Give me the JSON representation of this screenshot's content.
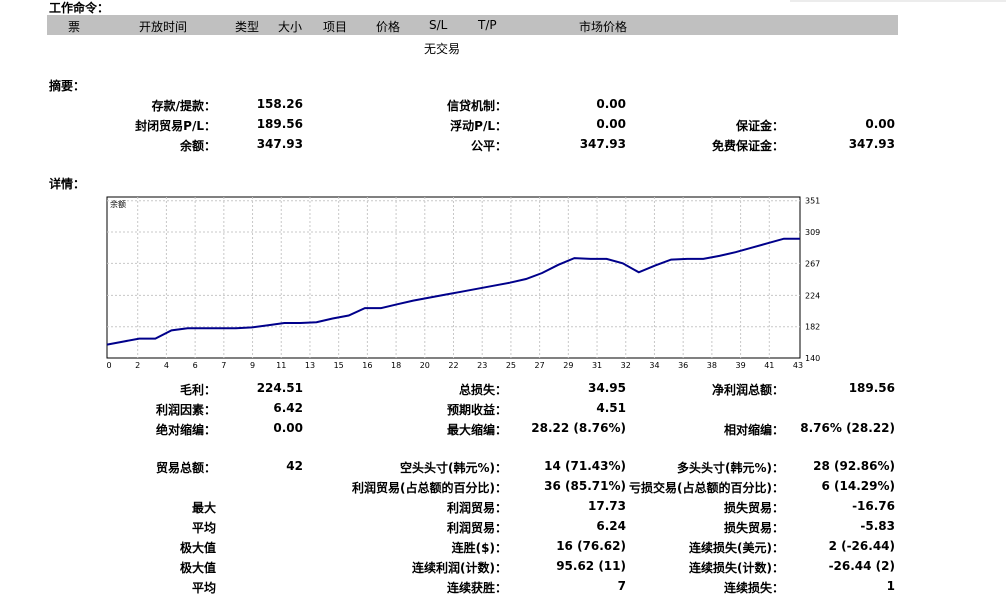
{
  "orders": {
    "title": "工作命令：",
    "columns": [
      "票",
      "开放时间",
      "类型",
      "大小",
      "项目",
      "价格",
      "S/L",
      "T/P",
      "市场价格"
    ],
    "empty_text": "无交易"
  },
  "summary": {
    "title": "摘要：",
    "deposit_label": "存款/提款：",
    "deposit": "158.26",
    "credit_label": "信贷机制：",
    "credit": "0.00",
    "closed_pl_label": "封闭贸易P/L：",
    "closed_pl": "189.56",
    "floating_pl_label": "浮动P/L：",
    "floating_pl": "0.00",
    "margin_label": "保证金：",
    "margin": "0.00",
    "balance_label": "余额：",
    "balance": "347.93",
    "equity_label": "公平：",
    "equity": "347.93",
    "free_margin_label": "免费保证金：",
    "free_margin": "347.93"
  },
  "details": {
    "title": "详情：",
    "gross_profit_label": "毛利：",
    "gross_profit": "224.51",
    "gross_loss_label": "总损失：",
    "gross_loss": "34.95",
    "net_profit_label": "净利润总额：",
    "net_profit": "189.56",
    "profit_factor_label": "利润因素：",
    "profit_factor": "6.42",
    "expected_payoff_label": "预期收益：",
    "expected_payoff": "4.51",
    "abs_dd_label": "绝对缩编：",
    "abs_dd": "0.00",
    "max_dd_label": "最大缩编：",
    "max_dd": "28.22 (8.76%)",
    "rel_dd_label": "相对缩编：",
    "rel_dd": "8.76% (28.22)",
    "total_trades_label": "贸易总额：",
    "total_trades": "42",
    "short_label": "空头头寸(韩元%)：",
    "short": "14 (71.43%)",
    "long_label": "多头头寸(韩元%)：",
    "long": "28 (92.86%)",
    "profit_trades_label": "利润贸易(占总额的百分比)：",
    "profit_trades": "36 (85.71%)",
    "loss_trades_label": "亏损交易(占总额的百分比)：",
    "loss_trades": "6 (14.29%)",
    "largest_label": "最大",
    "largest_profit_label": "利润贸易：",
    "largest_profit": "17.73",
    "largest_loss_label": "损失贸易：",
    "largest_loss": "-16.76",
    "average_label": "平均",
    "avg_profit_label": "利润贸易：",
    "avg_profit": "6.24",
    "avg_loss_label": "损失贸易：",
    "avg_loss": "-5.83",
    "max_label": "极大值",
    "cons_wins_label": "连胜($)：",
    "cons_wins": "16 (76.62)",
    "cons_losses_label": "连续损失(美元)：",
    "cons_losses": "2 (-26.44)",
    "maximal_label": "极大值",
    "cons_profit_label": "连续利润(计数)：",
    "cons_profit": "95.62 (11)",
    "cons_loss_label": "连续损失(计数)：",
    "cons_loss": "-26.44 (2)",
    "avg2_label": "平均",
    "avg_cons_wins_label": "连续获胜：",
    "avg_cons_wins": "7",
    "avg_cons_losses_label": "连续损失：",
    "avg_cons_losses": "1"
  },
  "chart_data": {
    "type": "line",
    "title": "余额",
    "line_color": "#00008b",
    "grid": true,
    "ylim": [
      140,
      356
    ],
    "xlim": [
      0,
      43
    ],
    "y_ticks": [
      "140",
      "182",
      "224",
      "267",
      "309",
      "351"
    ],
    "x_ticks": [
      "0",
      "2",
      "4",
      "6",
      "7",
      "9",
      "11",
      "13",
      "15",
      "16",
      "18",
      "20",
      "22",
      "23",
      "25",
      "27",
      "29",
      "31",
      "32",
      "34",
      "36",
      "38",
      "39",
      "41",
      "43"
    ],
    "series": [
      {
        "x": [
          0,
          1,
          2,
          3,
          4,
          5,
          6,
          7,
          8,
          9,
          10,
          11,
          12,
          13,
          14,
          15,
          16,
          17,
          18,
          19,
          20,
          21,
          22,
          23,
          24,
          25,
          26,
          27,
          28,
          29,
          30,
          31,
          32,
          33,
          34,
          35,
          36,
          37,
          38,
          39,
          40,
          41,
          42,
          43
        ],
        "values": [
          158,
          162,
          166,
          166,
          177,
          180,
          180,
          180,
          180,
          181,
          184,
          187,
          187,
          188,
          193,
          197,
          207,
          207,
          212,
          217,
          221,
          225,
          229,
          233,
          237,
          241,
          246,
          254,
          265,
          274,
          273,
          273,
          267,
          255,
          264,
          272,
          273,
          273,
          277,
          282,
          288,
          294,
          300,
          300
        ]
      }
    ]
  }
}
